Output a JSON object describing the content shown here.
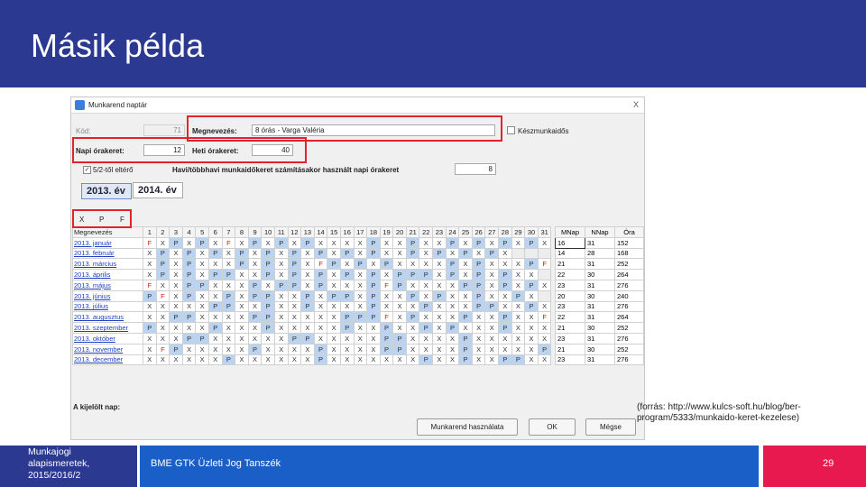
{
  "slide": {
    "title": "Másik példa",
    "source_note": "(forrás: http://www.kulcs-soft.hu/blog/ber-program/5333/munkaido-keret-kezelese)",
    "footer_left": "Munkajogi alapismeretek, 2015/2016/2",
    "footer_center": "BME GTK Üzleti Jog Tanszék",
    "page_number": "29",
    "colors": {
      "header": "#2b3990",
      "footer_mid": "#1a5fc7",
      "footer_right": "#e8194f",
      "highlight_box": "#e2232a",
      "p_cell": "#b9d3f0"
    }
  },
  "dialog": {
    "title": "Munkarend naptár",
    "close_label": "X",
    "kod_label": "Kód:",
    "kod_value": "71",
    "megnevezes_label": "Megnevezés:",
    "megnevezes_value": "8 órás - Varga Valéria",
    "keszmunkaido_label": "Készmunkaidős",
    "napi_label": "Napi órakeret:",
    "napi_value": "12",
    "heti_label": "Heti órakeret:",
    "heti_value": "40",
    "checkbox_label": "5/2-től eltérő",
    "havi_label": "Havi/többhavi munkaidőkeret számításakor használt napi órakeret",
    "havi_value": "8",
    "tabs": [
      "2013. év",
      "2014. év"
    ],
    "codes": [
      "X",
      "P",
      "F"
    ],
    "legend_footer": "A kijelölt nap:",
    "buttons": {
      "use": "Munkarend használata",
      "ok": "OK",
      "cancel": "Mégse"
    }
  },
  "calendar": {
    "month_header": "Megnevezés",
    "days": [
      "1",
      "2",
      "3",
      "4",
      "5",
      "6",
      "7",
      "8",
      "9",
      "10",
      "11",
      "12",
      "13",
      "14",
      "15",
      "16",
      "17",
      "18",
      "19",
      "20",
      "21",
      "22",
      "23",
      "24",
      "25",
      "26",
      "27",
      "28",
      "29",
      "30",
      "31"
    ],
    "rows": [
      {
        "month": "2013. január",
        "cells": "FXPXPXFXPXPXPXXXXPXXPXXPXPXPXPX"
      },
      {
        "month": "2013. február",
        "cells": "XPXPXPXPXPXPXPXPXPXXPXPXPXPX---"
      },
      {
        "month": "2013. március",
        "cells": "XPXPXXXPXPXPXFPXPXPXXXXPXPXXXPF"
      },
      {
        "month": "2013. április",
        "cells": "XPXPXPPXXPXPXPXPXPXPPPXPXPXPXX-"
      },
      {
        "month": "2013. május",
        "cells": "FXXPPXXXPXPPXPXXXPFPXXXXPPXPXPX"
      },
      {
        "month": "2013. június",
        "cells": "PFXPXXPXPPXXPXPPXPXXPXPXXPXXPX-"
      },
      {
        "month": "2013. július",
        "cells": "XXXXXPPXXPXXPXXXXPXXXPXXXPPXXPX"
      },
      {
        "month": "2013. augusztus",
        "cells": "XXPPXXXXPPXXXXXPPPFXPXXXPXXPXXF"
      },
      {
        "month": "2013. szeptember",
        "cells": "PXXXXPXXXPXXXXXPXXPXXPXPXXXPXXX"
      },
      {
        "month": "2013. október",
        "cells": "XXXPPXXXXXXPPXXXXXPPXXXXPXXXXXX"
      },
      {
        "month": "2013. november",
        "cells": "XFPXXXXXPXXXXPXXXXPPXXXXPXXXXXP"
      },
      {
        "month": "2013. december",
        "cells": "XXXXXXPXXXXXXPXXXXXXXPXXPXXPPXX"
      }
    ]
  },
  "summary": {
    "headers": [
      "MNap",
      "NNap",
      "Óra"
    ],
    "rows": [
      [
        "16",
        "31",
        "152"
      ],
      [
        "14",
        "28",
        "168"
      ],
      [
        "21",
        "31",
        "252"
      ],
      [
        "22",
        "30",
        "264"
      ],
      [
        "23",
        "31",
        "276"
      ],
      [
        "20",
        "30",
        "240"
      ],
      [
        "23",
        "31",
        "276"
      ],
      [
        "22",
        "31",
        "264"
      ],
      [
        "21",
        "30",
        "252"
      ],
      [
        "23",
        "31",
        "276"
      ],
      [
        "21",
        "30",
        "252"
      ],
      [
        "23",
        "31",
        "276"
      ]
    ]
  }
}
